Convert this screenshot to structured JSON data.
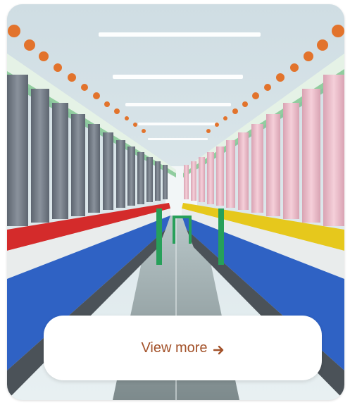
{
  "card": {
    "cta_label": "View more",
    "cta_icon": "arrow-right-icon",
    "cta_color": "#a3522a"
  },
  "colors": {
    "left_yarn": "#737b86",
    "right_yarn": "#eab9c6",
    "left_holders": "#d42b2b",
    "right_holders": "#e6c81c",
    "machine_belt": "#2f62c4",
    "accent_green": "#27a05a"
  }
}
